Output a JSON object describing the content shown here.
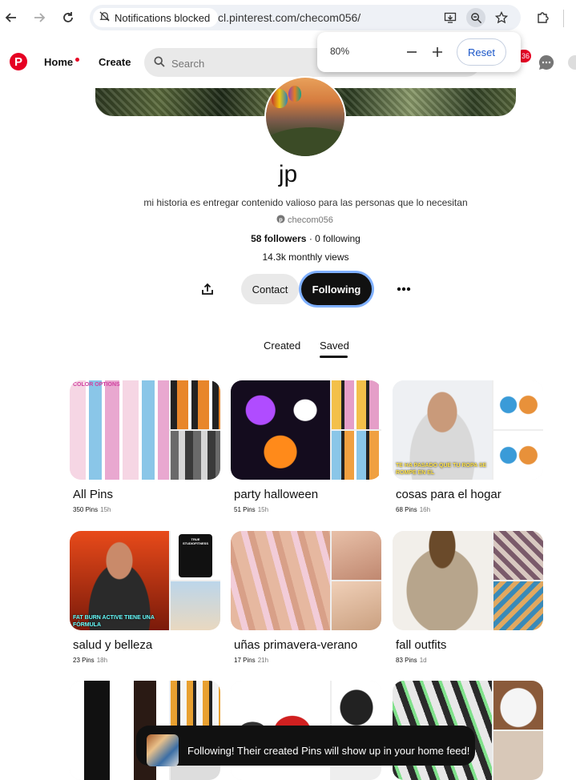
{
  "browser": {
    "notification_chip": "Notifications blocked",
    "url": "cl.pinterest.com/checom056/",
    "zoom_popup": {
      "level": "80%",
      "reset_label": "Reset"
    }
  },
  "header": {
    "logo": "P",
    "home_label": "Home",
    "create_label": "Create",
    "search_placeholder": "Search",
    "notification_count": "36"
  },
  "profile": {
    "name": "jp",
    "bio": "mi historia es entregar contenido valioso para las personas que lo necesitan",
    "handle": "checom056",
    "followers": "58 followers",
    "separator": " · ",
    "following": "0 following",
    "monthly_views": "14.3k monthly views",
    "contact_label": "Contact",
    "following_label": "Following"
  },
  "tabs": {
    "created": "Created",
    "saved": "Saved",
    "active": "saved"
  },
  "boards": [
    {
      "title": "All Pins",
      "count": "350 Pins",
      "time": "15h",
      "overlay_top": "COLOR OPTIONS"
    },
    {
      "title": "party halloween",
      "count": "51 Pins",
      "time": "15h"
    },
    {
      "title": "cosas para el hogar",
      "count": "68 Pins",
      "time": "16h",
      "overlay_bottom": "TE HA PASADO QUE TU ROPA SE ROMPE EN EL"
    },
    {
      "title": "salud y belleza",
      "count": "23 Pins",
      "time": "18h",
      "overlay_bottom": "FAT BURN ACTIVE TIENE UNA FÓRMULA",
      "overlay_side": "TRUE STUDIOFITNESS"
    },
    {
      "title": "uñas primavera-verano",
      "count": "17 Pins",
      "time": "21h"
    },
    {
      "title": "fall outfits",
      "count": "83 Pins",
      "time": "1d"
    },
    {
      "title": "",
      "count": "",
      "time": ""
    },
    {
      "title": "",
      "count": "",
      "time": ""
    },
    {
      "title": "",
      "count": "",
      "time": ""
    }
  ],
  "toast": {
    "message": "Following! Their created Pins will show up in your home feed!"
  },
  "colors": {
    "brand": "#e60023",
    "dark_button": "#111111",
    "focus_ring": "#7fb0ff",
    "link_blue": "#1a56c8"
  }
}
